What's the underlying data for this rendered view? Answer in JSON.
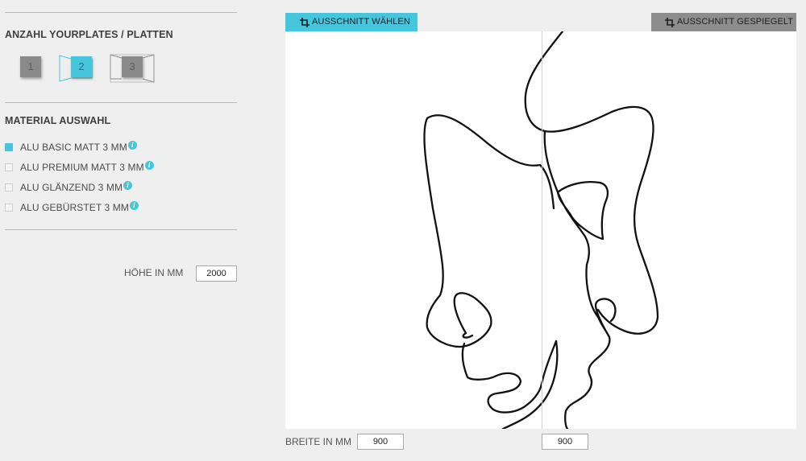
{
  "plates": {
    "title": "ANZAHL YOURPLATES / PLATTEN",
    "options": [
      "1",
      "2",
      "3"
    ],
    "selected": "2"
  },
  "material": {
    "title": "MATERIAL AUSWAHL",
    "items": [
      {
        "label": "ALU BASIC MATT 3 MM",
        "checked": true
      },
      {
        "label": "ALU PREMIUM MATT 3 MM",
        "checked": false
      },
      {
        "label": "ALU GLÄNZEND 3 MM",
        "checked": false
      },
      {
        "label": "ALU GEBÜRSTET 3 MM",
        "checked": false
      }
    ],
    "info_glyph": "i"
  },
  "height": {
    "label": "HÖHE IN MM",
    "value": "2000"
  },
  "width": {
    "label": "BREITE IN MM",
    "value_left": "900",
    "value_right": "900"
  },
  "toolbar": {
    "select_crop_label": "AUSSCHNITT WÄHLEN",
    "mirrored_crop_label": "AUSSCHNITT GESPIEGELT"
  },
  "colors": {
    "accent": "#45c6dd",
    "grey_button": "#8d8d8d",
    "background": "#efefef"
  }
}
